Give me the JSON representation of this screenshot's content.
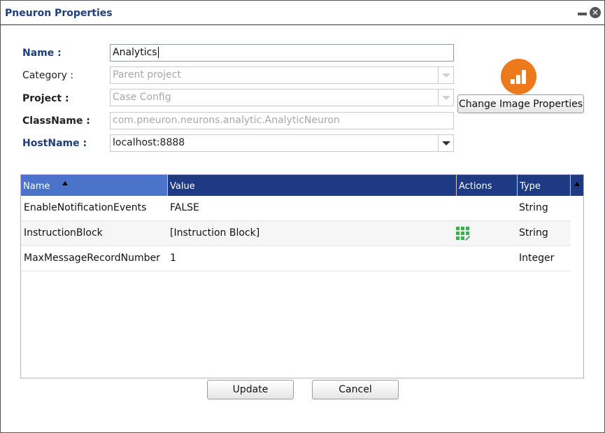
{
  "dialog": {
    "title": "Pneuron Properties"
  },
  "form": {
    "name_label": "Name :",
    "name_value": "Analytics",
    "category_label": "Category :",
    "category_value": "Parent project",
    "project_label": "Project :",
    "project_value": "Case Config",
    "classname_label": "ClassName :",
    "classname_value": "com.pneuron.neurons.analytic.AnalyticNeuron",
    "hostname_label": "HostName :",
    "hostname_value": "localhost:8888"
  },
  "image": {
    "icon": "orange-bar-chart-icon",
    "change_button": "Change Image Properties",
    "accent": "#ec7a1c"
  },
  "table": {
    "headers": {
      "name": "Name",
      "value": "Value",
      "actions": "Actions",
      "type": "Type"
    },
    "sort": {
      "column": "Name",
      "direction": "ascending"
    },
    "rows": [
      {
        "name": "EnableNotificationEvents",
        "value": "FALSE",
        "action_icon": "",
        "type": "String"
      },
      {
        "name": "InstructionBlock",
        "value": "[Instruction Block]",
        "action_icon": "grid-edit-icon",
        "type": "String"
      },
      {
        "name": "MaxMessageRecordNumber",
        "value": "1",
        "action_icon": "",
        "type": "Integer"
      }
    ]
  },
  "buttons": {
    "update": "Update",
    "cancel": "Cancel"
  },
  "colors": {
    "title": "#1f3e7a",
    "header": "#1f3a84",
    "header_sorted": "#4a73c9",
    "action_icon": "#3fae49"
  }
}
